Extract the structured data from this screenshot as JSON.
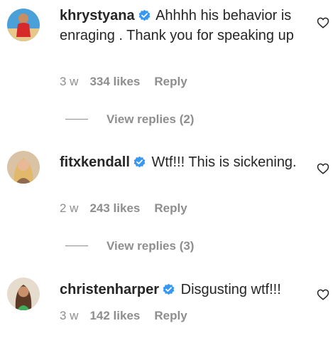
{
  "comments": [
    {
      "username": "khrystyana",
      "text": "Ahhhh his behavior is enraging . Thank you for speaking up",
      "time": "3 w",
      "likes": "334 likes",
      "reply": "Reply",
      "view_replies": "View replies (2)"
    },
    {
      "username": "fitxkendall",
      "text": "Wtf!!! This is sickening.",
      "time": "2 w",
      "likes": "243 likes",
      "reply": "Reply",
      "view_replies": "View replies (3)"
    },
    {
      "username": "christenharper",
      "text": "Disgusting wtf!!!",
      "time": "3 w",
      "likes": "142 likes",
      "reply": "Reply"
    }
  ],
  "colors": {
    "verified_badge": "#3897f0",
    "secondary_text": "#8e8e8e",
    "primary_text": "#262626"
  },
  "icons": {
    "verified": "verified-badge-icon",
    "like": "heart-outline-icon"
  }
}
